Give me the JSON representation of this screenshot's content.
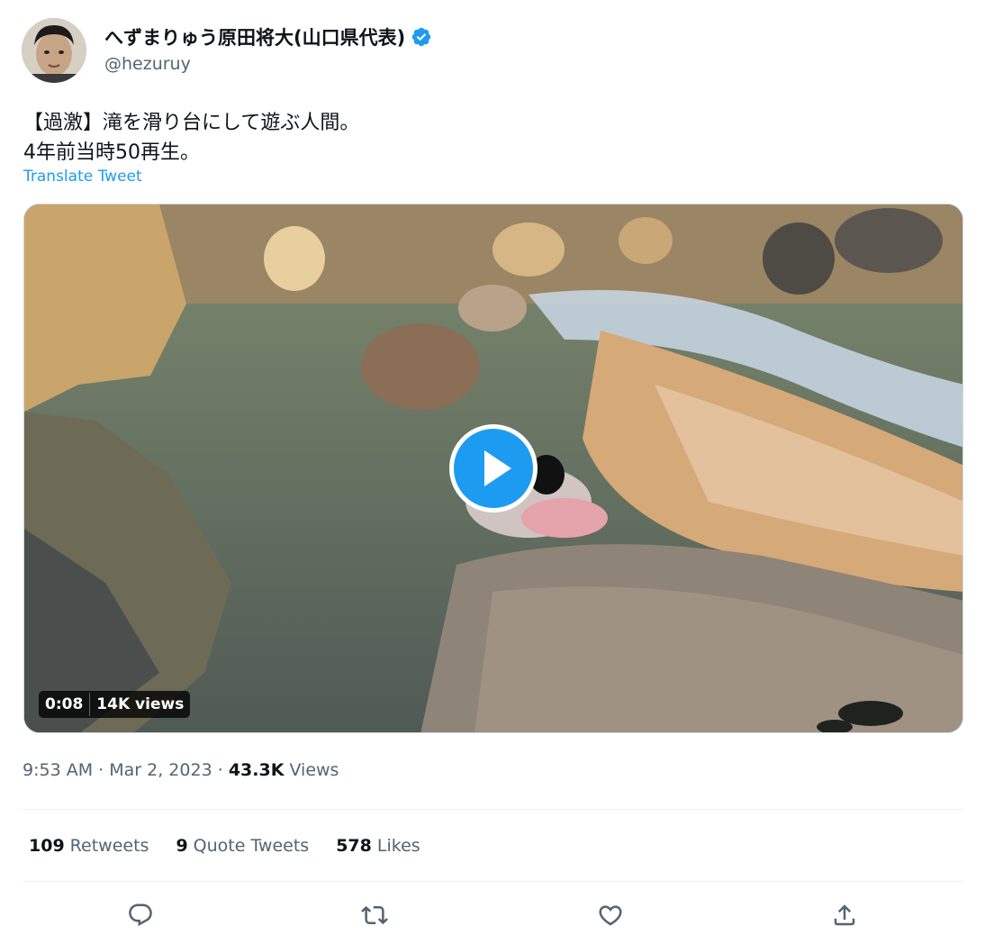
{
  "author": {
    "display_name": "へずまりゅう原田将大(山口県代表)",
    "handle": "@hezuruy",
    "verified": true
  },
  "tweet": {
    "text_lines": [
      "【過激】滝を滑り台にして遊ぶ人間。",
      "4年前当時50再生。"
    ],
    "translate_label": "Translate Tweet"
  },
  "media": {
    "duration": "0:08",
    "views": "14K views"
  },
  "meta": {
    "time": "9:53 AM",
    "separator": "·",
    "date": "Mar 2, 2023",
    "view_count": "43.3K",
    "view_label": "Views"
  },
  "stats": {
    "retweets": {
      "count": "109",
      "label": "Retweets"
    },
    "quotes": {
      "count": "9",
      "label": "Quote Tweets"
    },
    "likes": {
      "count": "578",
      "label": "Likes"
    }
  },
  "icons": {
    "reply": "reply-icon",
    "retweet": "retweet-icon",
    "like": "heart-icon",
    "share": "share-icon"
  },
  "colors": {
    "accent": "#1d9bf0",
    "text_primary": "#0f1419",
    "text_secondary": "#536471"
  }
}
